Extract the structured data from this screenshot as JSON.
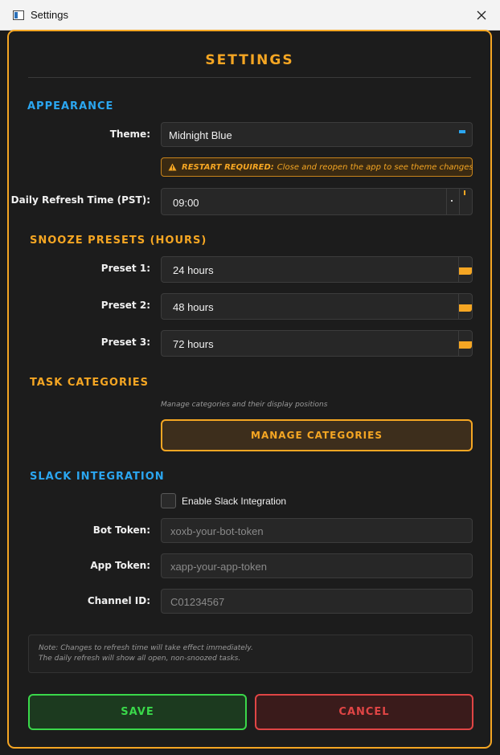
{
  "window": {
    "title": "Settings",
    "close_icon": "close-icon"
  },
  "colors": {
    "accent": "#f5a623",
    "info": "#2ba6f0",
    "success": "#3ad84a",
    "danger": "#e04545"
  },
  "settings": {
    "heading": "SETTINGS",
    "appearance": {
      "title": "APPEARANCE",
      "theme_label": "Theme:",
      "theme_value": "Midnight Blue",
      "warning_bold": "RESTART REQUIRED:",
      "warning_text": "Close and reopen the app to see theme changes",
      "refresh_label": "Daily Refresh Time (PST):",
      "refresh_value": "09:00"
    },
    "snooze": {
      "title": "SNOOZE PRESETS (HOURS)",
      "presets": [
        {
          "label": "Preset 1:",
          "value": "24 hours"
        },
        {
          "label": "Preset 2:",
          "value": "48 hours"
        },
        {
          "label": "Preset 3:",
          "value": "72 hours"
        }
      ]
    },
    "categories": {
      "title": "TASK CATEGORIES",
      "hint": "Manage categories and their display positions",
      "button": "MANAGE CATEGORIES"
    },
    "slack": {
      "title": "SLACK INTEGRATION",
      "enable_label": "Enable Slack Integration",
      "enabled": false,
      "bot_label": "Bot Token:",
      "bot_placeholder": "xoxb-your-bot-token",
      "app_label": "App Token:",
      "app_placeholder": "xapp-your-app-token",
      "channel_label": "Channel ID:",
      "channel_placeholder": "C01234567"
    },
    "note": {
      "line1": "Note: Changes to refresh time will take effect immediately.",
      "line2": "The daily refresh will show all open, non-snoozed tasks."
    },
    "actions": {
      "save": "SAVE",
      "cancel": "CANCEL"
    }
  }
}
